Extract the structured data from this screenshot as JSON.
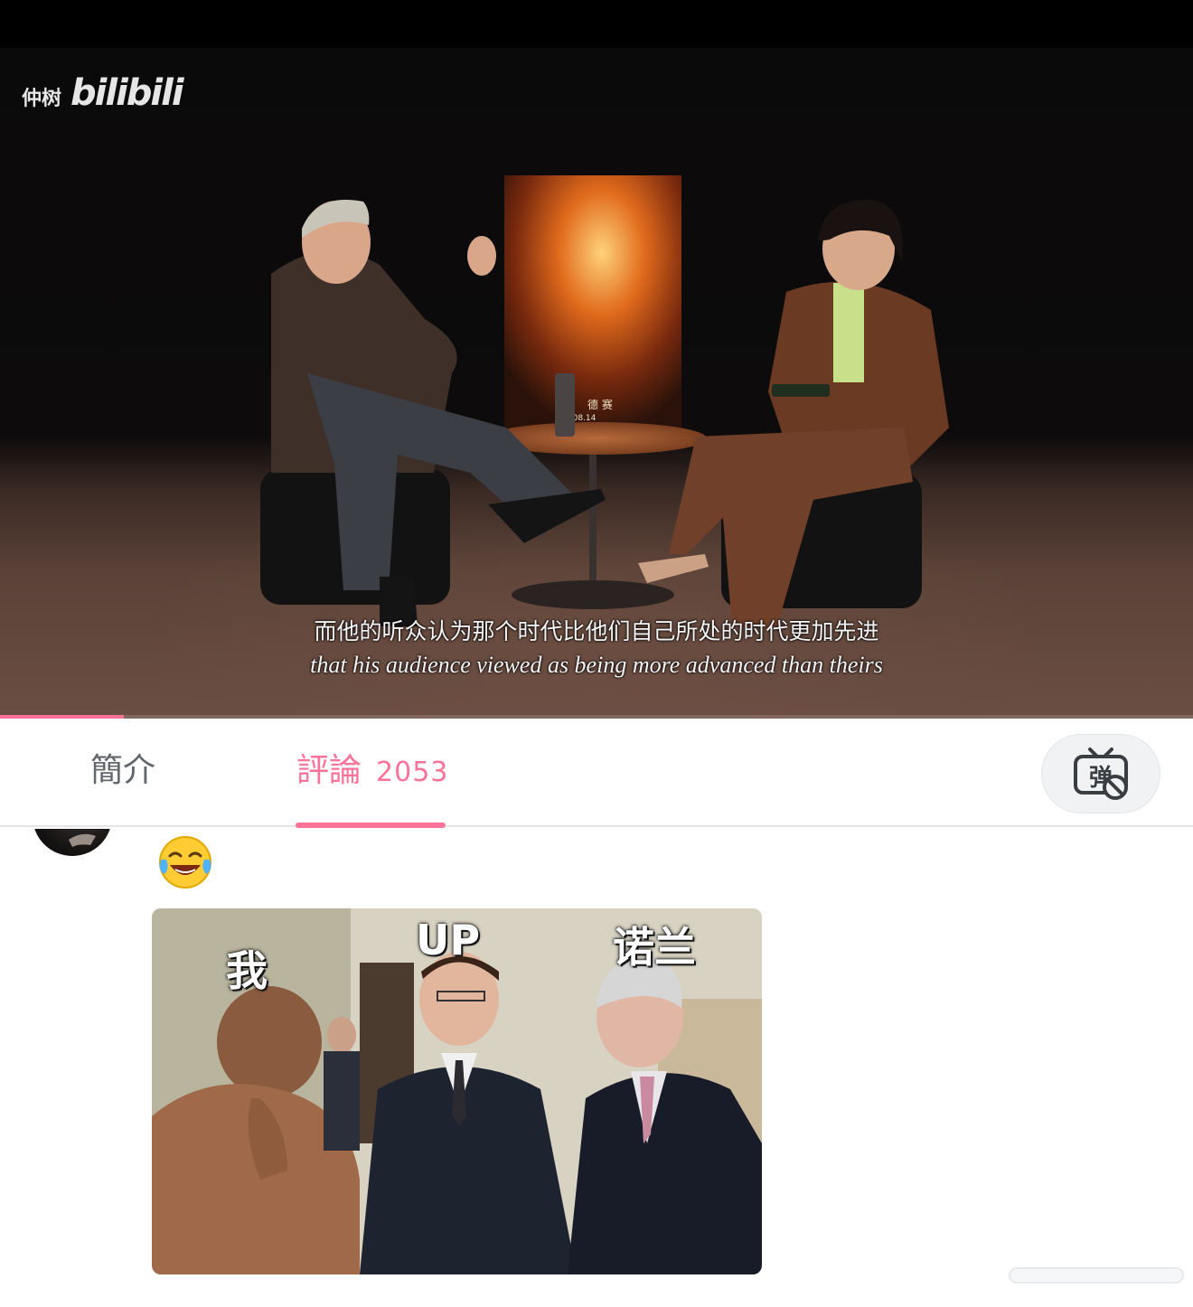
{
  "watermark": {
    "user": "仲树",
    "brand": "bilibili"
  },
  "video": {
    "subtitle_cn": "而他的听众认为那个时代比他们自己所处的时代更加先进",
    "subtitle_en": "that his audience viewed as being more advanced than theirs",
    "poster_text": "德 赛",
    "poster_date": "6.08.14",
    "progress_fraction": 0.104
  },
  "tabs": {
    "intro_label": "簡介",
    "comments_label": "評論",
    "comments_count": "2053",
    "active": "comments"
  },
  "danmaku_toggle": {
    "label": "弹",
    "state": "off"
  },
  "comment": {
    "emoji": "😂",
    "meme_labels": {
      "me": "我",
      "up": "UP",
      "nolan": "诺兰"
    }
  },
  "colors": {
    "accent": "#fb7299",
    "tab_inactive": "#61666d"
  },
  "icons": [
    "danmaku-off-icon",
    "laughing-emoji-icon"
  ]
}
